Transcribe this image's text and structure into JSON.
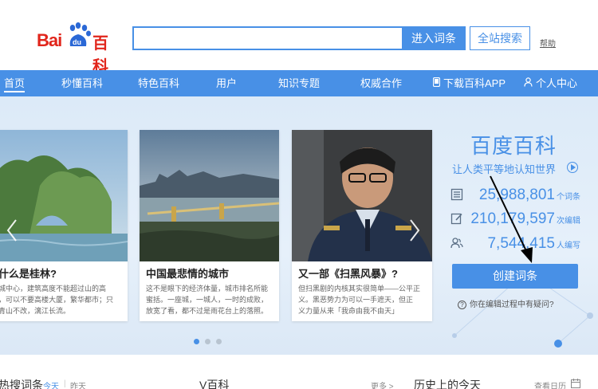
{
  "header": {
    "logo_bai": "Bai",
    "logo_du": "du",
    "logo_baike": "百科",
    "search": {
      "value": "",
      "placeholder": ""
    },
    "enter_button": "进入词条",
    "site_search_button": "全站搜索",
    "help_link": "帮助"
  },
  "nav": {
    "items": [
      {
        "label": "首页"
      },
      {
        "label": "秒懂百科"
      },
      {
        "label": "特色百科"
      },
      {
        "label": "用户"
      },
      {
        "label": "知识专题"
      },
      {
        "label": "权威合作"
      },
      {
        "label": "下载百科APP"
      },
      {
        "label": "个人中心"
      }
    ],
    "active": "首页"
  },
  "carousel": {
    "cards": [
      {
        "title": "什么是桂林?",
        "desc": "城中心，建筑高度不能超过山的高\n，可以不要高楼大厦，繁华都市；只\n青山不改，漓江长流。"
      },
      {
        "title": "中国最悲情的城市",
        "desc": "这不是眼下的经济体量，城市排名所能\n蜜括。一座城，一城人，一时的成败，\n放宽了看，都不过是雨花台上的落照。"
      },
      {
        "title": "又一部《扫黑风暴》?",
        "desc": "但扫黑剧的内核其实很简单——公平正\n义。黑恶势力为可以一手遮天，但正\n义力量从来「我命由我不由天」"
      }
    ],
    "dots": 3,
    "active_dot": 1
  },
  "brand": {
    "title": "百度百科",
    "slogan": "让人类平等地认知世界",
    "stats": [
      {
        "icon": "entries-icon",
        "value": "25,988,801",
        "unit": "个词条"
      },
      {
        "icon": "edit-icon",
        "value": "210,179,597",
        "unit": "次编辑"
      },
      {
        "icon": "users-icon",
        "value": "7,544,415",
        "unit": "人编写"
      }
    ],
    "create_button": "创建词条",
    "faq": "你在编辑过程中有疑问?"
  },
  "bottom": {
    "hot_title": "热搜词条",
    "today": "今天",
    "yesterday": "昨天",
    "v_baike": "V百科",
    "more": "更多 >",
    "history_title": "历史上的今天",
    "calendar": "查看日历"
  },
  "colors": {
    "accent": "#4890e6",
    "logo_red": "#e1251b",
    "banner_bg": "#dceaf8"
  }
}
